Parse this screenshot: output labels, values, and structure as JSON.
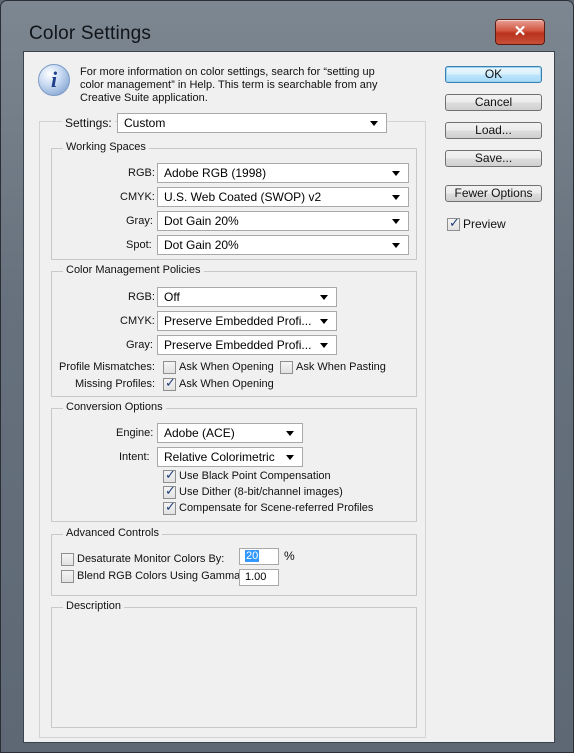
{
  "window": {
    "title": "Color Settings",
    "close_glyph": "✕"
  },
  "info": {
    "icon": "info-icon",
    "glyph": "i",
    "text": "For more information on color settings, search for “setting up color management” in Help. This term is searchable from any Creative Suite application."
  },
  "settings": {
    "label": "Settings:",
    "value": "Custom"
  },
  "working_spaces": {
    "title": "Working Spaces",
    "rgb": {
      "label": "RGB:",
      "value": "Adobe RGB (1998)"
    },
    "cmyk": {
      "label": "CMYK:",
      "value": "U.S. Web Coated (SWOP) v2"
    },
    "gray": {
      "label": "Gray:",
      "value": "Dot Gain 20%"
    },
    "spot": {
      "label": "Spot:",
      "value": "Dot Gain 20%"
    }
  },
  "policies": {
    "title": "Color Management Policies",
    "rgb": {
      "label": "RGB:",
      "value": "Off"
    },
    "cmyk": {
      "label": "CMYK:",
      "value": "Preserve Embedded Profi..."
    },
    "gray": {
      "label": "Gray:",
      "value": "Preserve Embedded Profi..."
    },
    "mismatch_label": "Profile Mismatches:",
    "ask_opening": {
      "label": "Ask When Opening",
      "checked": false
    },
    "ask_pasting": {
      "label": "Ask When Pasting",
      "checked": false
    },
    "missing_label": "Missing Profiles:",
    "missing_ask_opening": {
      "label": "Ask When Opening",
      "checked": true
    }
  },
  "conversion": {
    "title": "Conversion Options",
    "engine": {
      "label": "Engine:",
      "value": "Adobe (ACE)"
    },
    "intent": {
      "label": "Intent:",
      "value": "Relative Colorimetric"
    },
    "black_point": {
      "label": "Use Black Point Compensation",
      "checked": true
    },
    "dither": {
      "label": "Use Dither (8-bit/channel images)",
      "checked": true
    },
    "scene": {
      "label": "Compensate for Scene-referred Profiles",
      "checked": true
    }
  },
  "advanced": {
    "title": "Advanced Controls",
    "desaturate": {
      "label": "Desaturate Monitor Colors By:",
      "value": "20",
      "unit": "%",
      "checked": false
    },
    "blend": {
      "label": "Blend RGB Colors Using Gamma:",
      "value": "1.00",
      "checked": false
    }
  },
  "description": {
    "title": "Description"
  },
  "buttons": {
    "ok": "OK",
    "cancel": "Cancel",
    "load": "Load...",
    "save": "Save...",
    "fewer": "Fewer Options"
  },
  "preview": {
    "label": "Preview",
    "checked": true
  },
  "colors": {
    "frame": "#66717d",
    "client": "#f0f0f0",
    "close": "#c8503a",
    "accent": "#3399ff"
  }
}
